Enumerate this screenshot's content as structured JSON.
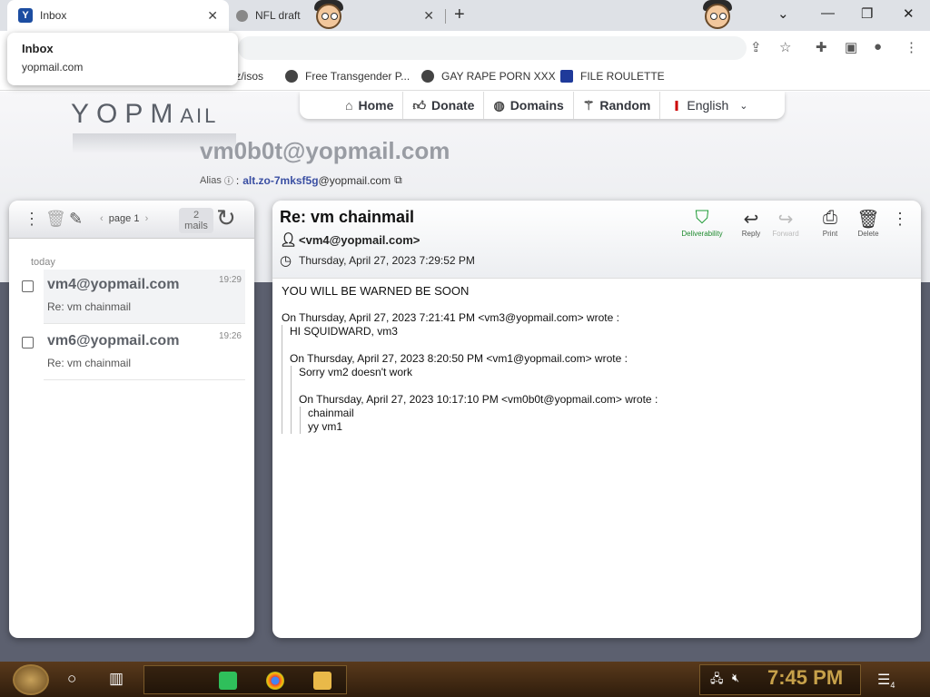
{
  "browser": {
    "tabs": [
      {
        "label": "Inbox",
        "active": true
      },
      {
        "label": "NFL draft",
        "active": false
      }
    ],
    "tooltip": {
      "title": "Inbox",
      "subtitle": "yopmail.com"
    },
    "bookmarks": [
      {
        "label": "tz/isos"
      },
      {
        "label": "Free Transgender P..."
      },
      {
        "label": "GAY RAPE PORN XXX"
      },
      {
        "label": "FILE ROULETTE"
      }
    ]
  },
  "site": {
    "logo_main": "YOPM",
    "logo_suffix": "AIL",
    "nav": [
      {
        "label": "Home",
        "icon": "home-icon"
      },
      {
        "label": "Donate",
        "icon": "thumbs-up-icon"
      },
      {
        "label": "Domains",
        "icon": "globe-icon"
      },
      {
        "label": "Random",
        "icon": "magic-wand-icon"
      }
    ],
    "language": "English",
    "email": "vm0b0t@yopmail.com",
    "alias_label": "Alias",
    "alias_name": "alt.zo-7mksf5g",
    "alias_domain": "@yopmail.com"
  },
  "inbox": {
    "page_label": "page 1",
    "count_number": "2",
    "count_label": "mails",
    "group_label": "today",
    "mails": [
      {
        "from": "vm4@yopmail.com",
        "subject": "Re: vm chainmail",
        "time": "19:29"
      },
      {
        "from": "vm6@yopmail.com",
        "subject": "Re: vm chainmail",
        "time": "19:26"
      }
    ]
  },
  "message": {
    "subject": "Re: vm chainmail",
    "from": "<vm4@yopmail.com>",
    "date": "Thursday, April 27, 2023 7:29:52 PM",
    "actions": {
      "deliverability": "Deliverability",
      "reply": "Reply",
      "forward": "Forward",
      "print": "Print",
      "delete": "Delete"
    },
    "body": {
      "line1": "YOU WILL BE WARNED BE SOON",
      "q1_header": "On Thursday, April 27, 2023 7:21:41 PM <vm3@yopmail.com> wrote :",
      "q1_text": "HI SQUIDWARD, vm3",
      "q2_header": "On Thursday, April 27, 2023 8:20:50 PM <vm1@yopmail.com> wrote :",
      "q2_text": "Sorry vm2 doesn't work",
      "q3_header": "On Thursday, April 27, 2023 10:17:10 PM <vm0b0t@yopmail.com> wrote :",
      "q3_text1": "chainmail",
      "q3_text2": "yy vm1"
    }
  },
  "taskbar": {
    "clock": "7:45 PM",
    "notification_count": "4"
  },
  "colors": {
    "brand_blue": "#1c4da1",
    "deliverability_green": "#1f9b36",
    "alias_blue": "#3a4fa3",
    "clock_gold": "#c7a14a"
  }
}
